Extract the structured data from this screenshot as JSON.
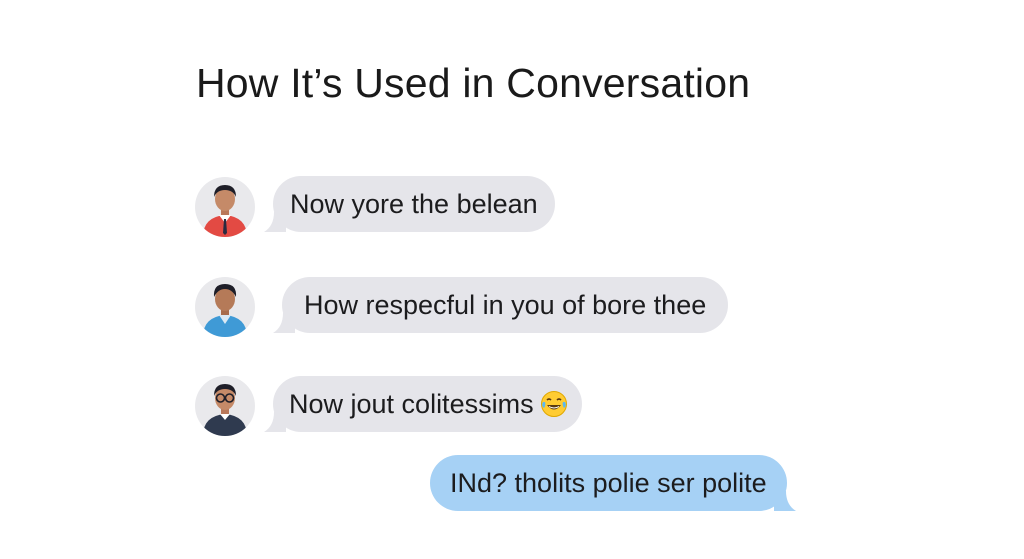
{
  "title": "How It’s Used in Conversation",
  "messages": [
    {
      "text": "Now yore the belean",
      "side": "incoming",
      "avatar_icon": "man-red-shirt-icon"
    },
    {
      "text": "How respecful in you of bore thee",
      "side": "incoming",
      "avatar_icon": "man-blue-shirt-icon"
    },
    {
      "text": "Now jout colitessims",
      "side": "incoming",
      "avatar_icon": "man-glasses-icon",
      "emoji": "laughing-tears-emoji"
    },
    {
      "text": "INd? tholits polie ser polite",
      "side": "outgoing"
    }
  ],
  "colors": {
    "incoming_bubble": "#e5e5ea",
    "outgoing_bubble": "#a6d1f5",
    "avatar_background": "#e9e9ec"
  }
}
